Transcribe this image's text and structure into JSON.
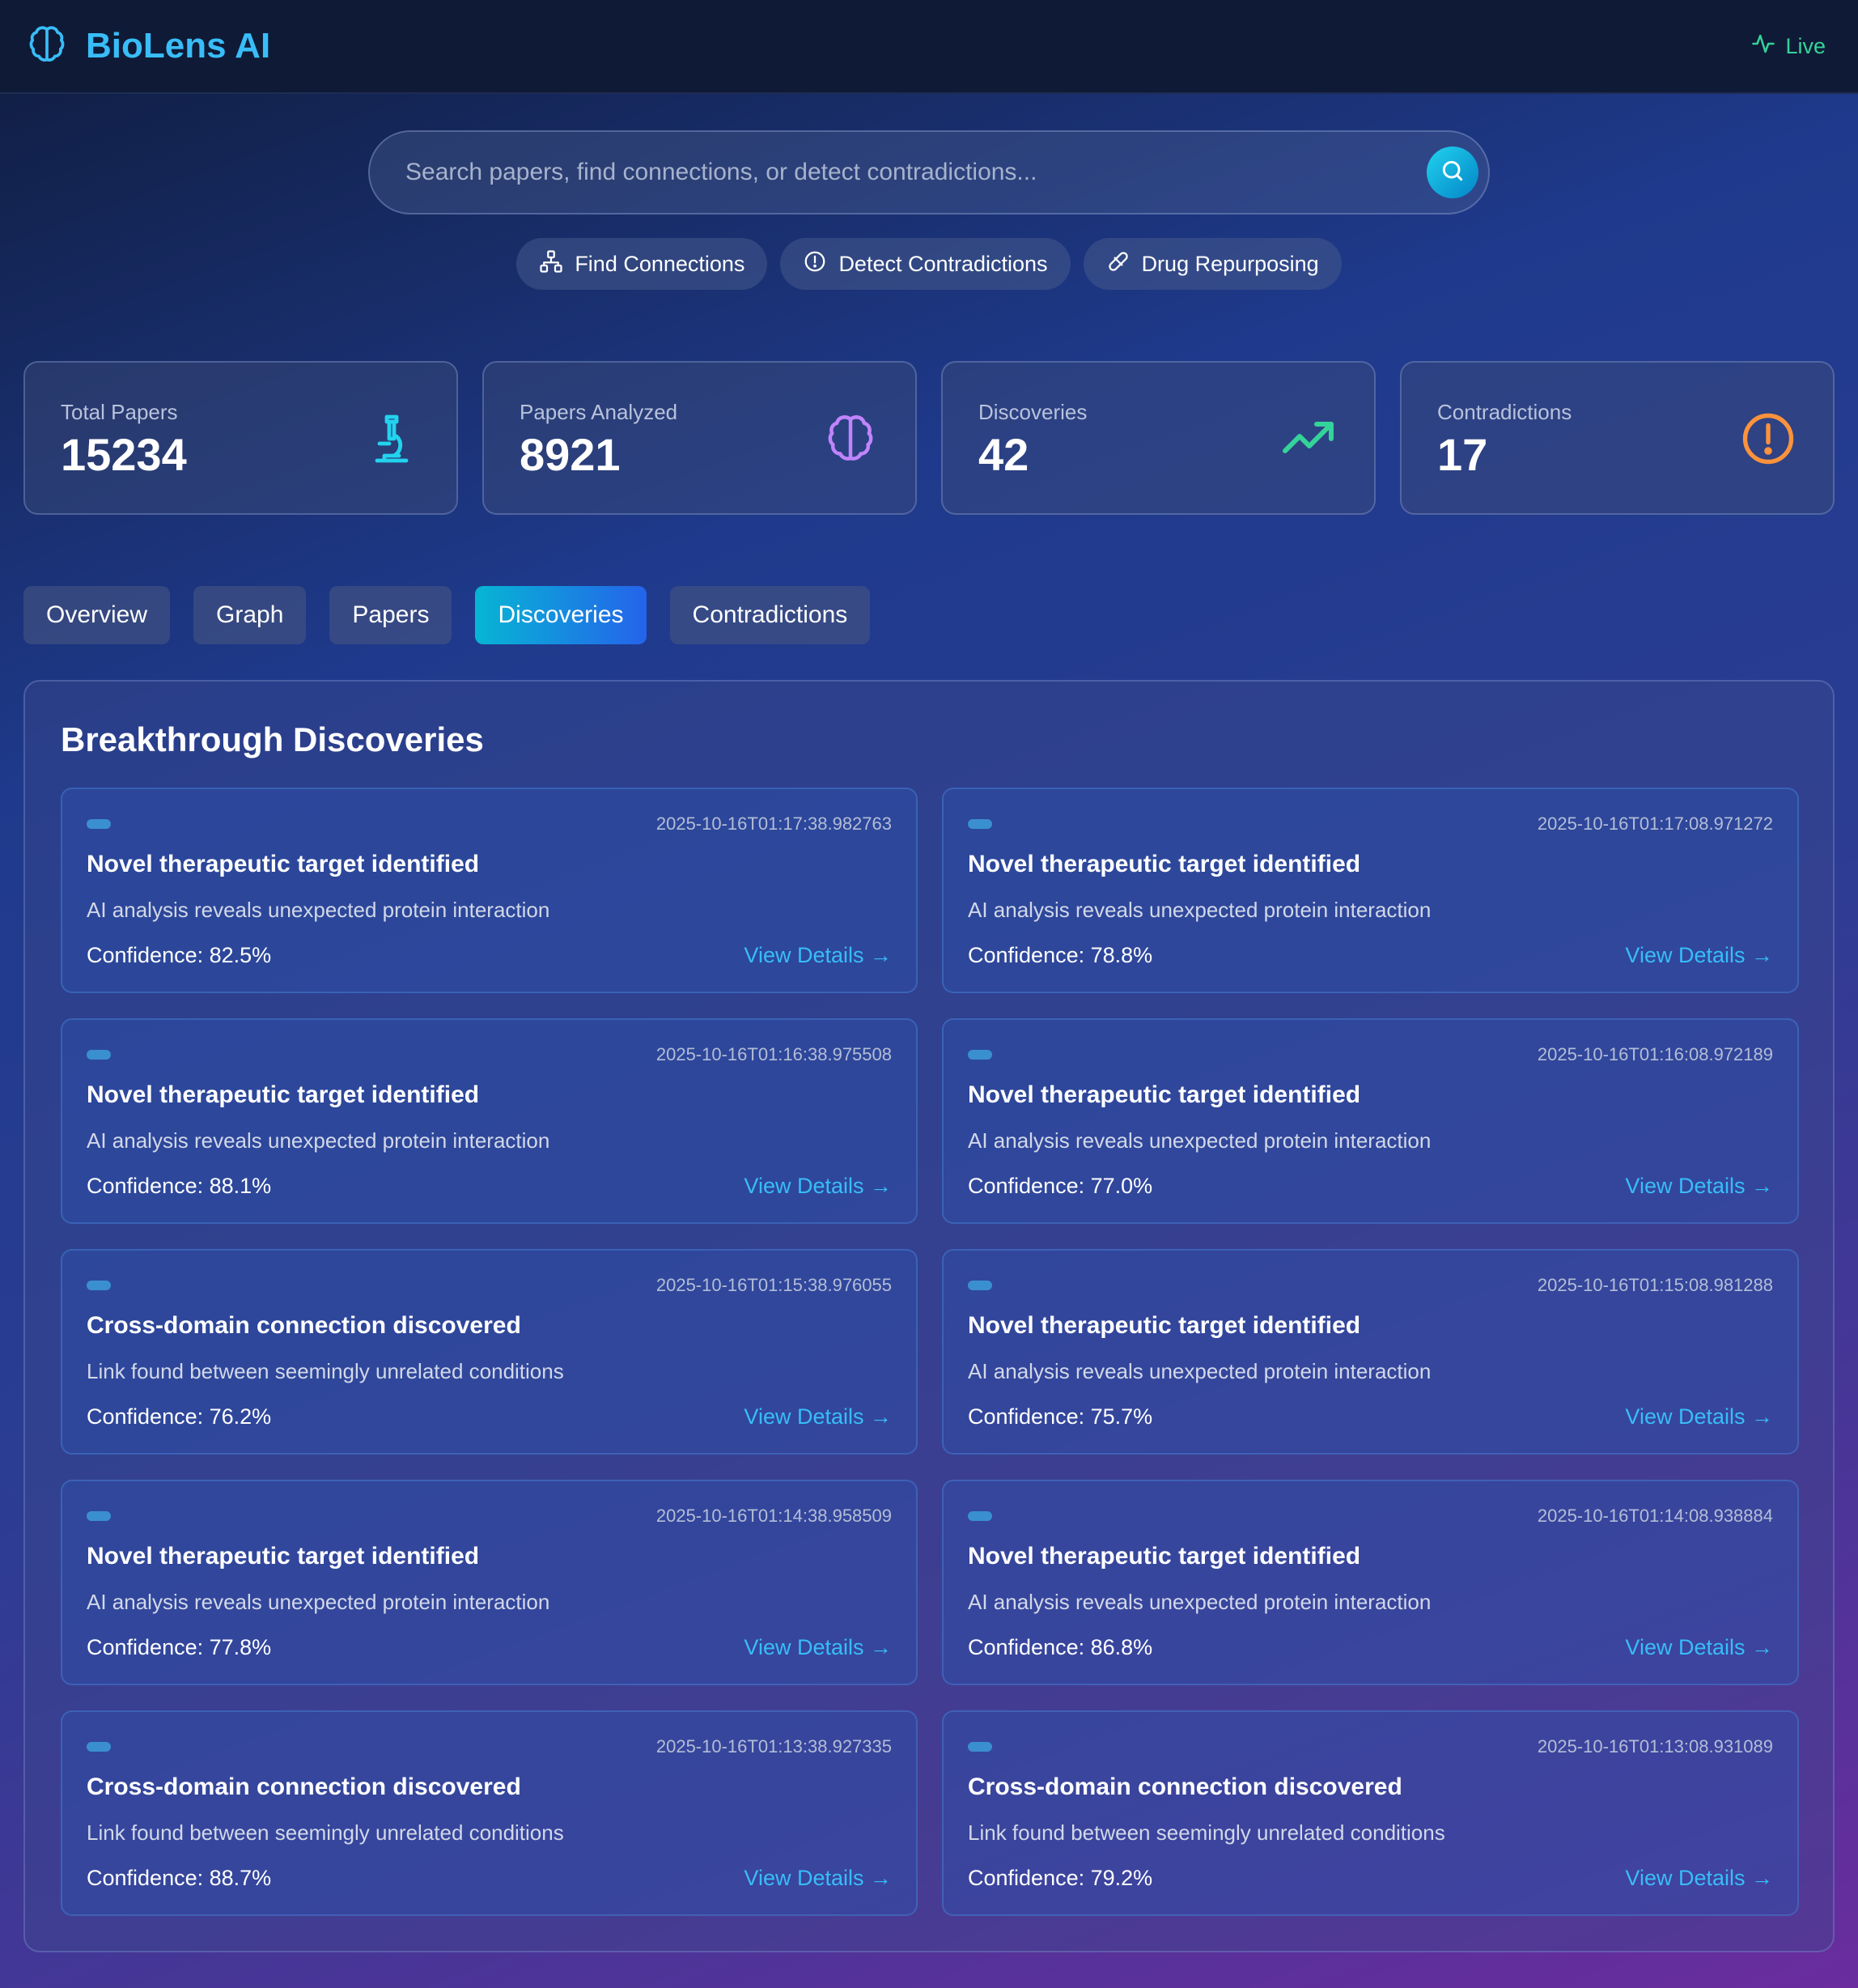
{
  "header": {
    "brand": "BioLens AI",
    "status": "Live"
  },
  "search": {
    "placeholder": "Search papers, find connections, or detect contradictions...",
    "value": ""
  },
  "quick_actions": [
    {
      "label": "Find Connections",
      "icon": "network-icon"
    },
    {
      "label": "Detect Contradictions",
      "icon": "alert-circle-icon"
    },
    {
      "label": "Drug Repurposing",
      "icon": "pill-icon"
    }
  ],
  "stats": [
    {
      "label": "Total Papers",
      "value": "15234",
      "icon": "microscope-icon",
      "color": "#22d3ee"
    },
    {
      "label": "Papers Analyzed",
      "value": "8921",
      "icon": "brain-icon",
      "color": "#c084fc"
    },
    {
      "label": "Discoveries",
      "value": "42",
      "icon": "trending-up-icon",
      "color": "#34d399"
    },
    {
      "label": "Contradictions",
      "value": "17",
      "icon": "alert-circle-icon",
      "color": "#fb923c"
    }
  ],
  "tabs": [
    {
      "label": "Overview",
      "active": false
    },
    {
      "label": "Graph",
      "active": false
    },
    {
      "label": "Papers",
      "active": false
    },
    {
      "label": "Discoveries",
      "active": true
    },
    {
      "label": "Contradictions",
      "active": false
    }
  ],
  "panel": {
    "title": "Breakthrough Discoveries"
  },
  "discoveries": [
    {
      "timestamp": "2025-10-16T01:17:38.982763",
      "title": "Novel therapeutic target identified",
      "description": "AI analysis reveals unexpected protein interaction",
      "confidence": "Confidence: 82.5%",
      "link": "View Details →"
    },
    {
      "timestamp": "2025-10-16T01:17:08.971272",
      "title": "Novel therapeutic target identified",
      "description": "AI analysis reveals unexpected protein interaction",
      "confidence": "Confidence: 78.8%",
      "link": "View Details →"
    },
    {
      "timestamp": "2025-10-16T01:16:38.975508",
      "title": "Novel therapeutic target identified",
      "description": "AI analysis reveals unexpected protein interaction",
      "confidence": "Confidence: 88.1%",
      "link": "View Details →"
    },
    {
      "timestamp": "2025-10-16T01:16:08.972189",
      "title": "Novel therapeutic target identified",
      "description": "AI analysis reveals unexpected protein interaction",
      "confidence": "Confidence: 77.0%",
      "link": "View Details →"
    },
    {
      "timestamp": "2025-10-16T01:15:38.976055",
      "title": "Cross-domain connection discovered",
      "description": "Link found between seemingly unrelated conditions",
      "confidence": "Confidence: 76.2%",
      "link": "View Details →"
    },
    {
      "timestamp": "2025-10-16T01:15:08.981288",
      "title": "Novel therapeutic target identified",
      "description": "AI analysis reveals unexpected protein interaction",
      "confidence": "Confidence: 75.7%",
      "link": "View Details →"
    },
    {
      "timestamp": "2025-10-16T01:14:38.958509",
      "title": "Novel therapeutic target identified",
      "description": "AI analysis reveals unexpected protein interaction",
      "confidence": "Confidence: 77.8%",
      "link": "View Details →"
    },
    {
      "timestamp": "2025-10-16T01:14:08.938884",
      "title": "Novel therapeutic target identified",
      "description": "AI analysis reveals unexpected protein interaction",
      "confidence": "Confidence: 86.8%",
      "link": "View Details →"
    },
    {
      "timestamp": "2025-10-16T01:13:38.927335",
      "title": "Cross-domain connection discovered",
      "description": "Link found between seemingly unrelated conditions",
      "confidence": "Confidence: 88.7%",
      "link": "View Details →"
    },
    {
      "timestamp": "2025-10-16T01:13:08.931089",
      "title": "Cross-domain connection discovered",
      "description": "Link found between seemingly unrelated conditions",
      "confidence": "Confidence: 79.2%",
      "link": "View Details →"
    }
  ],
  "colors": {
    "accent": "#38bdf8",
    "live": "#34d399",
    "warning": "#fb923c",
    "tab_active_start": "#06b6d4",
    "tab_active_end": "#2563eb"
  }
}
